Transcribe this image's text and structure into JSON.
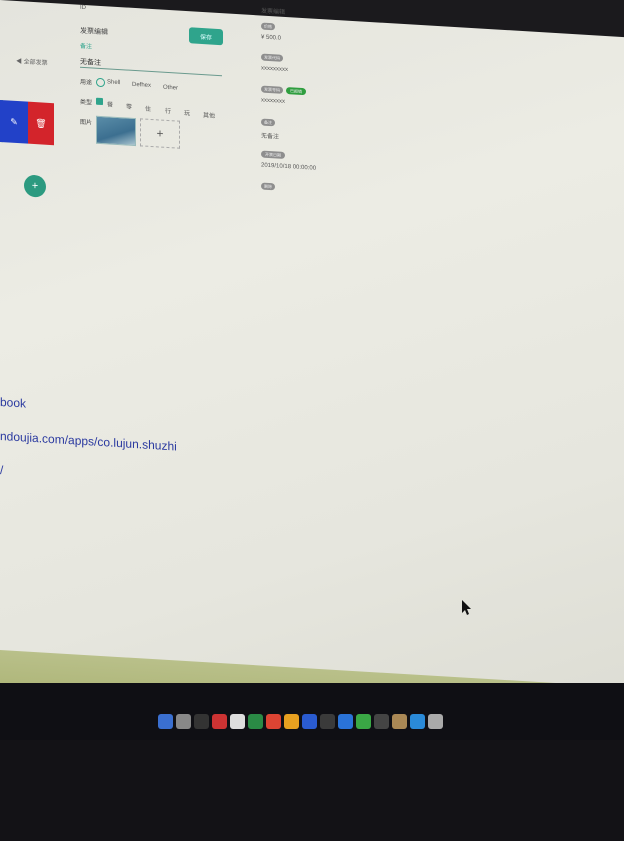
{
  "form": {
    "title": "发票编辑",
    "save_button": "保存",
    "hint": "备注",
    "name_value": "无备注",
    "purpose_label": "用途",
    "purpose_options": [
      "Shell",
      "Defhex",
      "Other"
    ],
    "type_label": "类型",
    "type_options": [
      "餐",
      "零",
      "住",
      "行",
      "玩",
      "其他"
    ],
    "image_label": "图片",
    "add_symbol": "+"
  },
  "left_panel": {
    "back_label": "◀ 全部发票",
    "edit_icon": "pencil-icon",
    "delete_icon": "trash-icon",
    "fab_symbol": "+"
  },
  "detail": {
    "header": "发票编辑",
    "price_tag": "价格",
    "price_value": "¥ 500.0",
    "code_tag": "发票代码",
    "code_value": "xxxxxxxxx",
    "number_tag": "发票号码",
    "number_status": "已报销",
    "number_value": "xxxxxxxx",
    "remark_tag": "备注",
    "remark_value": "无备注",
    "date_tag": "开票日期",
    "date_value": "2019/10/18 00:00:00",
    "delete_tag": "删除"
  },
  "links": [
    "book",
    "ndoujia.com/apps/co.lujun.shuzhi",
    "/"
  ],
  "dock": {
    "icon_colors": [
      "#3a6fd0",
      "#888",
      "#333",
      "#c33",
      "#ddd",
      "#2a8a45",
      "#d43",
      "#e7a020",
      "#2a5bd0",
      "#3a3a3a",
      "#2a73d8",
      "#3aa845",
      "#444",
      "#a85",
      "#2a8ad8",
      "#aaa"
    ]
  }
}
